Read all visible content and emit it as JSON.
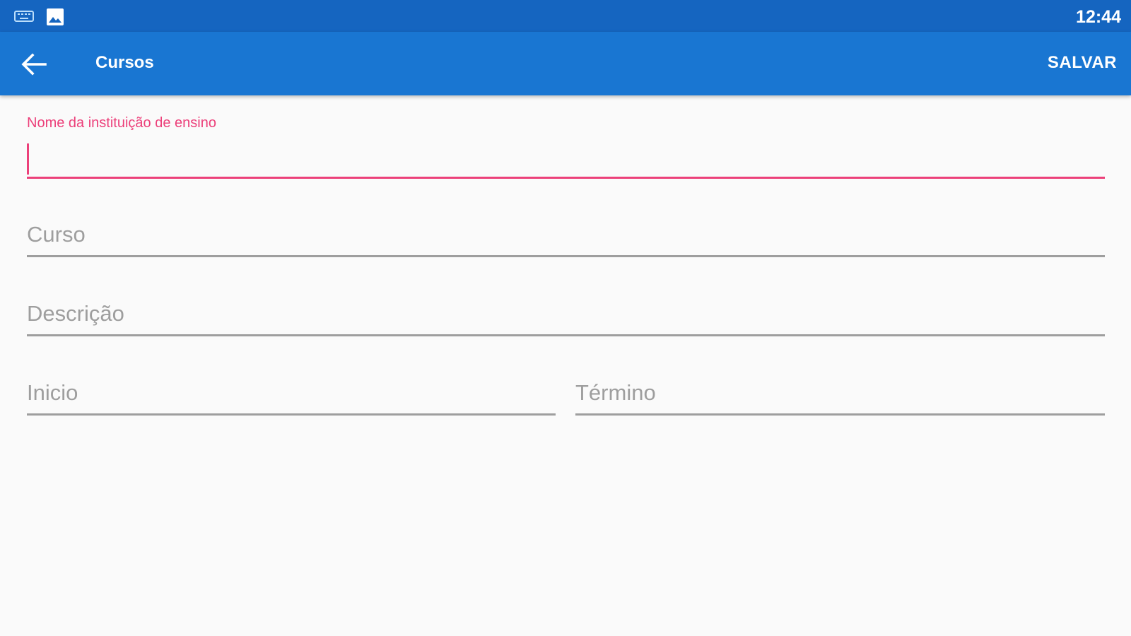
{
  "status_bar": {
    "time": "12:44",
    "icons": [
      "keyboard-icon",
      "picture-icon"
    ]
  },
  "app_bar": {
    "back_icon": "arrow-back-icon",
    "title": "Cursos",
    "save_label": "SALVAR",
    "color": "#1976d2",
    "status_color": "#1565c0"
  },
  "form": {
    "institution": {
      "label": "Nome da instituição de ensino",
      "value": ""
    },
    "course": {
      "placeholder": "Curso"
    },
    "description": {
      "placeholder": "Descrição"
    },
    "start": {
      "placeholder": "Inicio"
    },
    "end": {
      "placeholder": "Término"
    },
    "accent_color": "#ec407a"
  }
}
